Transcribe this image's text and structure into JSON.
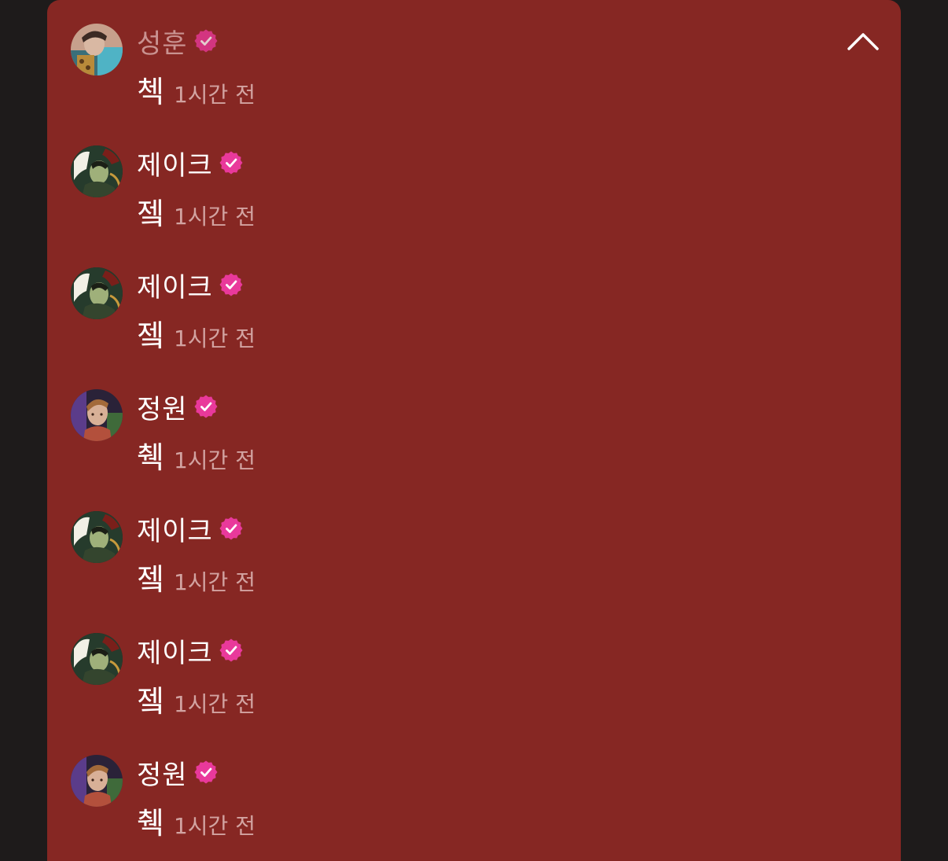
{
  "colors": {
    "background": "#1e1b1b",
    "panel": "#862723",
    "verified_badge": "#e9399b",
    "timestamp": "#d2a3a1"
  },
  "panel": {
    "collapse_icon": "chevron-up-icon"
  },
  "comments": [
    {
      "author": "성훈",
      "avatar": "avatar-sunghoon",
      "verified": true,
      "text": "첵",
      "time": "1시간 전"
    },
    {
      "author": "제이크",
      "avatar": "avatar-jake",
      "verified": true,
      "text": "젴",
      "time": "1시간 전"
    },
    {
      "author": "제이크",
      "avatar": "avatar-jake",
      "verified": true,
      "text": "젴",
      "time": "1시간 전"
    },
    {
      "author": "정원",
      "avatar": "avatar-jungwon",
      "verified": true,
      "text": "췍",
      "time": "1시간 전"
    },
    {
      "author": "제이크",
      "avatar": "avatar-jake",
      "verified": true,
      "text": "젴",
      "time": "1시간 전"
    },
    {
      "author": "제이크",
      "avatar": "avatar-jake",
      "verified": true,
      "text": "젴",
      "time": "1시간 전"
    },
    {
      "author": "정원",
      "avatar": "avatar-jungwon",
      "verified": true,
      "text": "췍",
      "time": "1시간 전"
    }
  ]
}
